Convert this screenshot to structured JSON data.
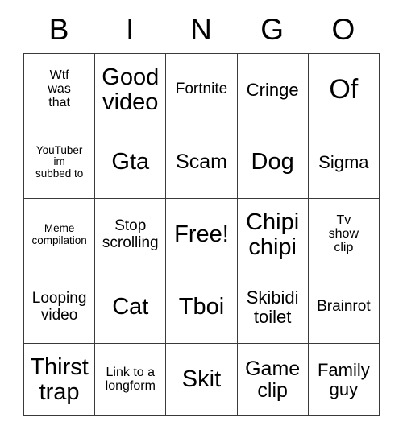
{
  "card": {
    "headers": [
      "B",
      "I",
      "N",
      "G",
      "O"
    ],
    "rows": [
      [
        {
          "text": "Wtf\nwas\nthat",
          "size": "fs-xxs"
        },
        {
          "text": "Good\nvideo",
          "size": "fs-lg"
        },
        {
          "text": "Fortnite",
          "size": "fs-xs"
        },
        {
          "text": "Cringe",
          "size": "fs-sm"
        },
        {
          "text": "Of",
          "size": "fs-xl"
        }
      ],
      [
        {
          "text": "YouTuber\nim\nsubbed to",
          "size": "fs-tiny"
        },
        {
          "text": "Gta",
          "size": "fs-lg"
        },
        {
          "text": "Scam",
          "size": "fs-md"
        },
        {
          "text": "Dog",
          "size": "fs-lg"
        },
        {
          "text": "Sigma",
          "size": "fs-sm"
        }
      ],
      [
        {
          "text": "Meme\ncompilation",
          "size": "fs-tiny"
        },
        {
          "text": "Stop\nscrolling",
          "size": "fs-xs"
        },
        {
          "text": "Free!",
          "size": "fs-lg"
        },
        {
          "text": "Chipi\nchipi",
          "size": "fs-lg"
        },
        {
          "text": "Tv\nshow\nclip",
          "size": "fs-xxs"
        }
      ],
      [
        {
          "text": "Looping\nvideo",
          "size": "fs-xs"
        },
        {
          "text": "Cat",
          "size": "fs-lg"
        },
        {
          "text": "Tboi",
          "size": "fs-lg"
        },
        {
          "text": "Skibidi\ntoilet",
          "size": "fs-sm"
        },
        {
          "text": "Brainrot",
          "size": "fs-xs"
        }
      ],
      [
        {
          "text": "Thirst\ntrap",
          "size": "fs-lg"
        },
        {
          "text": "Link to a\nlongform",
          "size": "fs-xxs"
        },
        {
          "text": "Skit",
          "size": "fs-lg"
        },
        {
          "text": "Game\nclip",
          "size": "fs-md"
        },
        {
          "text": "Family\nguy",
          "size": "fs-sm"
        }
      ]
    ],
    "free_space_label": "Free!",
    "colors": {
      "text": "#000000",
      "grid_line": "#3a3a3a",
      "background": "#ffffff"
    }
  }
}
